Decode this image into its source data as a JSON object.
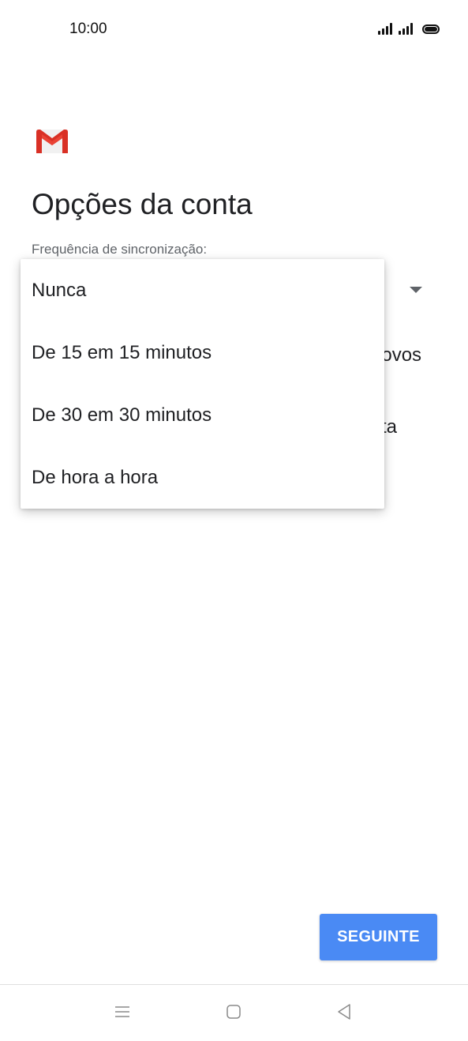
{
  "status_bar": {
    "time": "10:00",
    "icons": [
      "signal-icon",
      "signal-icon",
      "battery-icon"
    ]
  },
  "app": {
    "logo": "gmail-logo-icon",
    "brand_colors": {
      "red": "#d93025",
      "light_red": "#ea4335",
      "gray": "#c5c5c5"
    }
  },
  "page": {
    "title": "Opções da conta",
    "sync_label": "Frequência de sincronização:",
    "background_text_1": "novos",
    "background_text_2": "ta"
  },
  "sync_menu": {
    "options": [
      {
        "label": "Nunca"
      },
      {
        "label": "De 15 em 15 minutos"
      },
      {
        "label": "De 30 em 30 minutos"
      },
      {
        "label": "De hora a hora"
      }
    ]
  },
  "actions": {
    "next_label": "SEGUINTE",
    "next_color": "#4a8af4"
  },
  "nav_bar": {
    "icons": [
      "menu-icon",
      "home-icon",
      "back-icon"
    ]
  }
}
